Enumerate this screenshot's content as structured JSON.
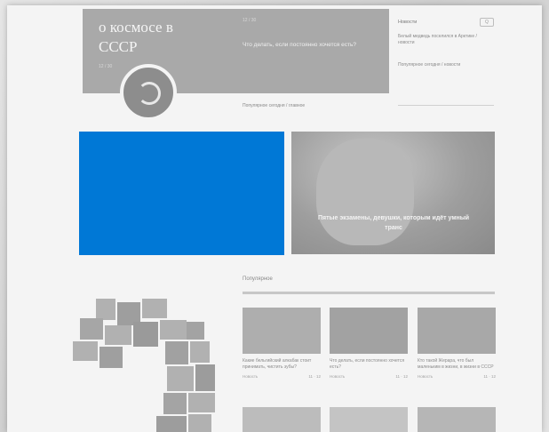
{
  "hero": {
    "title": "о космосе в СССР",
    "small_top": "12 / 30",
    "small_bottom": "12 / 30",
    "question": "Что делать, если постоянно хочется есть?"
  },
  "caption": "Популярное сегодня / главное",
  "sidebar": {
    "label": "Новости",
    "search_label": "Q",
    "text_1": "Белый медведь поселился в Арктике / новости",
    "text_2": "Популярное сегодня / новости"
  },
  "promo": {
    "text": "Пятые экзамены, девушки, которым идёт умный транс"
  },
  "section": {
    "title": "Популярное"
  },
  "cards": [
    {
      "text": "Какие бельгийский алкабак стоит принимать, чистить зубы?",
      "meta_left": "Новость",
      "meta_right": "11 · 12"
    },
    {
      "text": "Что делать, если постоянно хочется есть?",
      "meta_left": "Новость",
      "meta_right": "11 · 12"
    },
    {
      "text": "Кто такой Жерара, что был маленьким в жизни, в жизни в СССР",
      "meta_left": "Новость",
      "meta_right": "11 · 12"
    }
  ],
  "colors": {
    "accent_blue": "#0078d6",
    "hero_gray": "#a9a9a9"
  }
}
